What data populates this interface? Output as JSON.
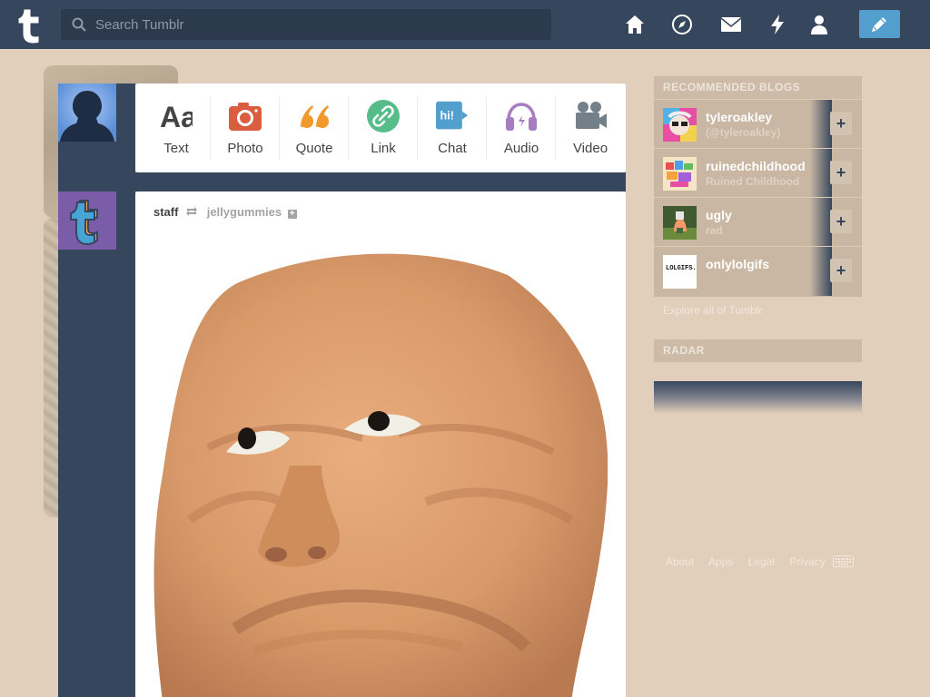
{
  "header": {
    "search_placeholder": "Search Tumblr",
    "nav_icons": [
      "home-icon",
      "explore-compass-icon",
      "inbox-envelope-icon",
      "activity-lightning-icon",
      "account-person-icon"
    ],
    "compose_icon": "pencil-icon",
    "accent": "#529ecc",
    "bar_color": "#36465d"
  },
  "post_types": [
    {
      "label": "Text",
      "icon": "text-aa-icon",
      "color": "#444444"
    },
    {
      "label": "Photo",
      "icon": "camera-icon",
      "color": "#d95e40"
    },
    {
      "label": "Quote",
      "icon": "quote-icon",
      "color": "#f2992e"
    },
    {
      "label": "Link",
      "icon": "link-icon",
      "color": "#56bc8a"
    },
    {
      "label": "Chat",
      "icon": "chat-bubble-icon",
      "color": "#529ecc"
    },
    {
      "label": "Audio",
      "icon": "headphones-icon",
      "color": "#a77dc2"
    },
    {
      "label": "Video",
      "icon": "video-camera-icon",
      "color": "#748089"
    }
  ],
  "chat_icon_text": "hi!",
  "post": {
    "blog": "staff",
    "reblogged_from": "jellygummies",
    "follow_glyph": "+"
  },
  "sidebar": {
    "recommended_title": "RECOMMENDED BLOGS",
    "blogs": [
      {
        "name": "tyleroakley",
        "subtitle": "(@tyleroakley)"
      },
      {
        "name": "ruinedchildhood",
        "subtitle": "Ruined Childhood"
      },
      {
        "name": "ugly",
        "subtitle": "rad"
      },
      {
        "name": "onlylolgifs",
        "subtitle": ""
      }
    ],
    "follow_glyph": "+",
    "avatar_text_onlylolgifs": "LOLGIFS. NET",
    "explore_link": "Explore all of Tumblr",
    "radar_title": "RADAR"
  },
  "footer": {
    "links": [
      "About",
      "Apps",
      "Legal",
      "Privacy"
    ],
    "keyboard_icon": "keyboard-icon"
  }
}
